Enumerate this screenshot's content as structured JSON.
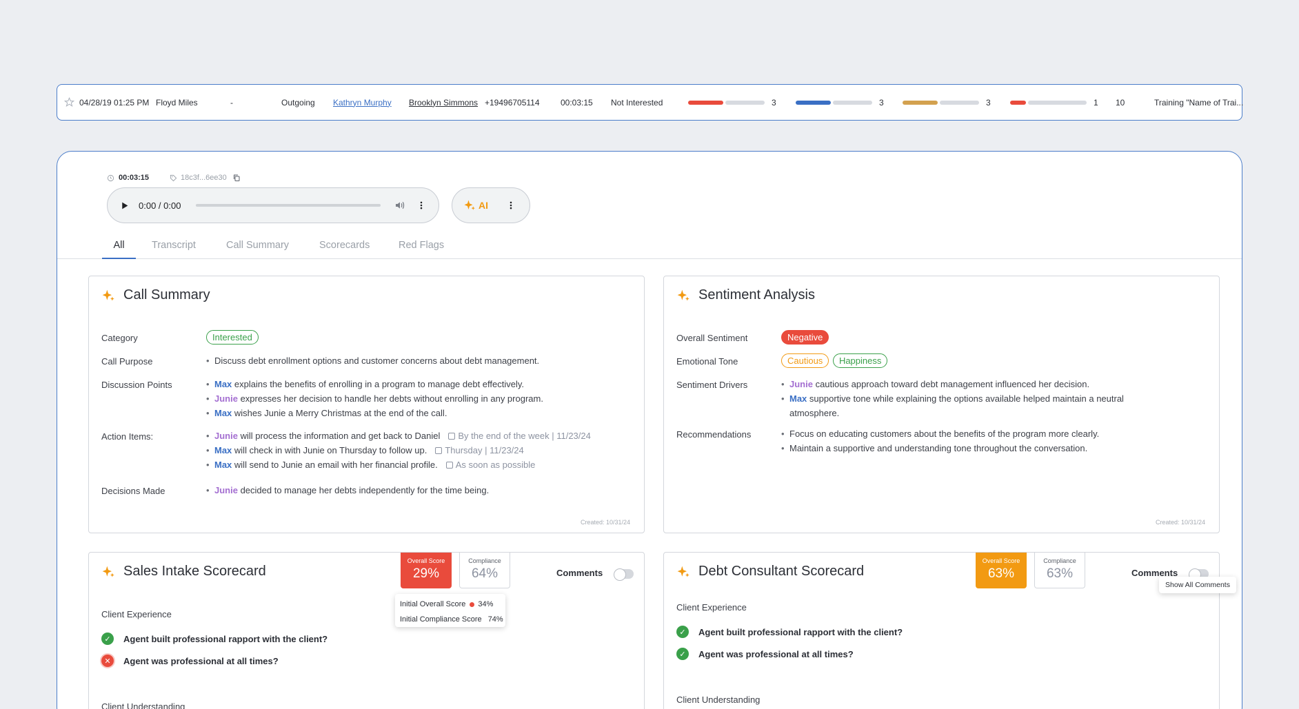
{
  "row": {
    "datetime": "04/28/19 01:25 PM",
    "agent": "Floyd Miles",
    "dash": "-",
    "direction": "Outgoing",
    "contact": "Kathryn Murphy",
    "customer": "Brooklyn Simmons",
    "phone": "+19496705114",
    "duration": "00:03:15",
    "disposition": "Not Interested",
    "bars": [
      {
        "color": "#e94b3c",
        "fraction": 0.47,
        "value": "3"
      },
      {
        "color": "#3a6fc4",
        "fraction": 0.47,
        "value": "3"
      },
      {
        "color": "#d3a14f",
        "fraction": 0.47,
        "value": "3"
      },
      {
        "color": "#e94b3c",
        "fraction": 0.21,
        "value": "1"
      }
    ],
    "count": "10",
    "training": "Training \"Name of Trai..."
  },
  "player": {
    "duration": "00:03:15",
    "id": "18c3f...6ee30",
    "time": "0:00 / 0:00",
    "ai_label": "AI"
  },
  "tabs": [
    "All",
    "Transcript",
    "Call Summary",
    "Scorecards",
    "Red Flags"
  ],
  "call_summary": {
    "title": "Call Summary",
    "category_label": "Category",
    "category_value": "Interested",
    "purpose_label": "Call Purpose",
    "purpose": "Discuss debt enrollment options and customer concerns about debt management.",
    "discussion_label": "Discussion Points",
    "discussion": [
      {
        "who": "Max",
        "text": " explains the benefits of enrolling in a program to manage debt effectively."
      },
      {
        "who": "Junie",
        "text": " expresses her decision to handle her debts without enrolling in any program."
      },
      {
        "who": "Max",
        "text": " wishes Junie a Merry Christmas at the end of the call."
      }
    ],
    "actions_label": "Action Items:",
    "actions": [
      {
        "who": "Junie",
        "text": " will process the information and get back to Daniel",
        "due": "By the end of the week | 11/23/24"
      },
      {
        "who": "Max",
        "text": " will check in with Junie on Thursday to follow up.",
        "due": "Thursday | 11/23/24"
      },
      {
        "who": "Max",
        "text": " will send to Junie an email with her financial profile.",
        "due": "As soon as possible"
      }
    ],
    "decisions_label": "Decisions Made",
    "decisions": [
      {
        "who": "Junie",
        "text": " decided to manage her debts independently for the time being."
      }
    ],
    "created": "Created: 10/31/24"
  },
  "sentiment": {
    "title": "Sentiment Analysis",
    "overall_label": "Overall Sentiment",
    "overall": "Negative",
    "tone_label": "Emotional Tone",
    "tones": [
      "Cautious",
      "Happiness"
    ],
    "drivers_label": "Sentiment Drivers",
    "drivers": [
      {
        "who": "Junie",
        "text": " cautious approach toward debt management influenced her decision."
      },
      {
        "who": "Max",
        "text": " supportive tone while explaining the options available helped maintain a neutral atmosphere."
      }
    ],
    "rec_label": "Recommendations",
    "recommendations": [
      "Focus on educating customers about the benefits of the program more clearly.",
      "Maintain a supportive and understanding tone throughout the conversation."
    ],
    "created": "Created: 10/31/24"
  },
  "sales": {
    "title": "Sales Intake Scorecard",
    "overall_label": "Overall Score",
    "overall": "29%",
    "compliance_label": "Compliance",
    "compliance": "64%",
    "comments": "Comments",
    "tooltip_overall_label": "Initial Overall Score",
    "tooltip_overall": "34%",
    "tooltip_compliance_label": "Initial Compliance Score",
    "tooltip_compliance": "74%",
    "section1": "Client Experience",
    "items": [
      {
        "text": "Agent built professional rapport with the client?",
        "ok": true
      },
      {
        "text": "Agent was professional at all times?",
        "ok": false
      }
    ],
    "section2": "Client Understanding"
  },
  "debt": {
    "title": "Debt Consultant Scorecard",
    "overall_label": "Overall Score",
    "overall": "63%",
    "compliance_label": "Compliance",
    "compliance": "63%",
    "comments": "Comments",
    "show_all": "Show All Comments",
    "section1": "Client Experience",
    "items": [
      {
        "text": "Agent built professional rapport with the client?",
        "ok": true
      },
      {
        "text": "Agent was professional at all times?",
        "ok": true
      }
    ],
    "section2": "Client Understanding"
  },
  "colors": {
    "accent": "#3a6fc4",
    "ai": "#f29a12",
    "negative": "#e94b3c",
    "positive": "#3aa04a"
  }
}
